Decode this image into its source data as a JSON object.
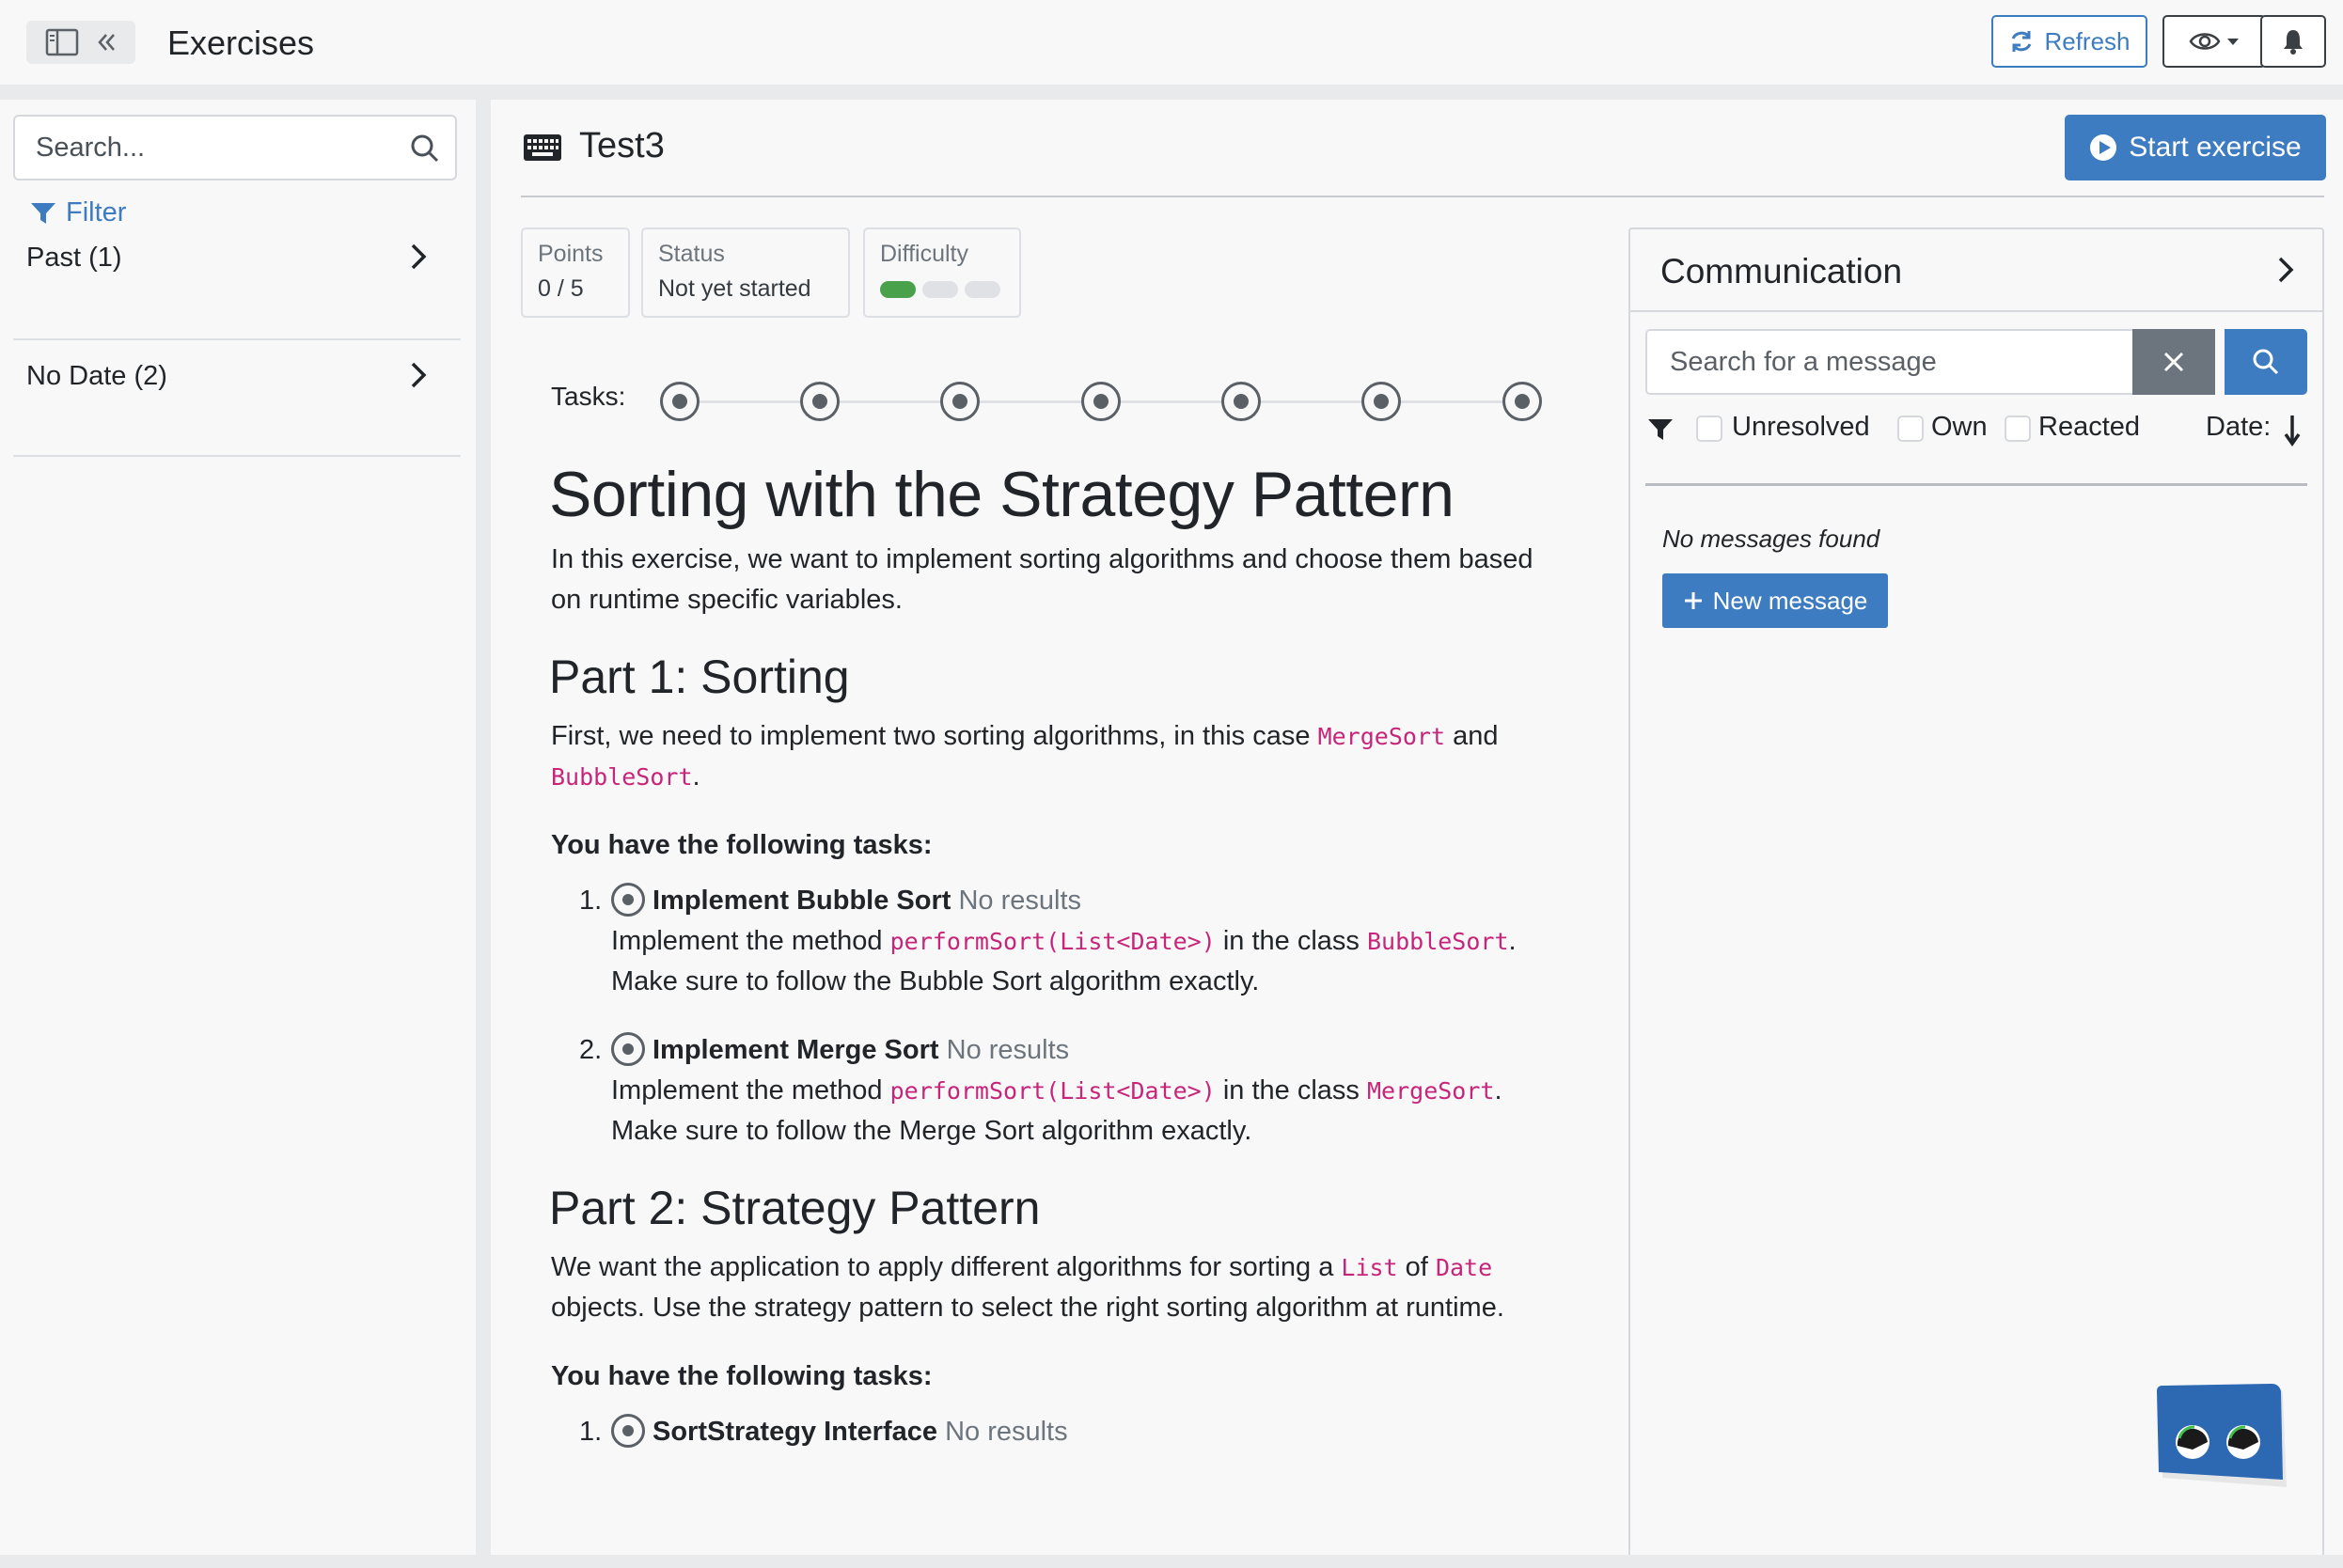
{
  "topbar": {
    "title": "Exercises",
    "refresh_label": "Refresh"
  },
  "sidebar": {
    "search_placeholder": "Search...",
    "filter_label": "Filter",
    "groups": [
      {
        "label": "Past (1)"
      },
      {
        "label": "No Date (2)"
      }
    ]
  },
  "exercise": {
    "title": "Test3",
    "start_label": "Start exercise",
    "stats": {
      "points_key": "Points",
      "points_value": "0 / 5",
      "status_key": "Status",
      "status_value": "Not yet started",
      "difficulty_key": "Difficulty",
      "difficulty_level": 1,
      "difficulty_max": 3
    },
    "tasks_label": "Tasks:",
    "task_count": 7,
    "content": {
      "h1": "Sorting with the Strategy Pattern",
      "intro": "In this exercise, we want to implement sorting algorithms and choose them based on runtime specific variables.",
      "part1_title": "Part 1: Sorting",
      "part1_text_a": "First, we need to implement two sorting algorithms, in this case ",
      "part1_code_a": "MergeSort",
      "part1_text_b": " and ",
      "part1_code_b": "BubbleSort",
      "part1_text_c": ".",
      "tasks_heading": "You have the following tasks:",
      "part1_tasks": [
        {
          "num": "1.",
          "title": "Implement Bubble Sort",
          "status": "No results",
          "line1_a": "Implement the method ",
          "line1_code": "performSort(List<Date>)",
          "line1_b": " in the class ",
          "line1_class": "BubbleSort",
          "line1_c": ".",
          "line2": "Make sure to follow the Bubble Sort algorithm exactly."
        },
        {
          "num": "2.",
          "title": "Implement Merge Sort",
          "status": "No results",
          "line1_a": "Implement the method ",
          "line1_code": "performSort(List<Date>)",
          "line1_b": " in the class ",
          "line1_class": "MergeSort",
          "line1_c": ".",
          "line2": "Make sure to follow the Merge Sort algorithm exactly."
        }
      ],
      "part2_title": "Part 2: Strategy Pattern",
      "part2_text_a": "We want the application to apply different algorithms for sorting a ",
      "part2_code_a": "List",
      "part2_text_b": " of ",
      "part2_code_b": "Date",
      "part2_text_c": " objects. Use the strategy pattern to select the right sorting algorithm at runtime.",
      "part2_tasks_heading": "You have the following tasks:",
      "part2_task1_num": "1.",
      "part2_task1_title": "SortStrategy Interface",
      "part2_task1_status": "No results"
    }
  },
  "communication": {
    "title": "Communication",
    "search_placeholder": "Search for a message",
    "filters": [
      "Unresolved",
      "Own",
      "Reacted"
    ],
    "date_label": "Date:",
    "no_messages": "No messages found",
    "new_message_label": "New message"
  },
  "colors": {
    "accent": "#3e7cc1",
    "code": "#c7257a",
    "difficulty_on": "#4aa14c"
  }
}
